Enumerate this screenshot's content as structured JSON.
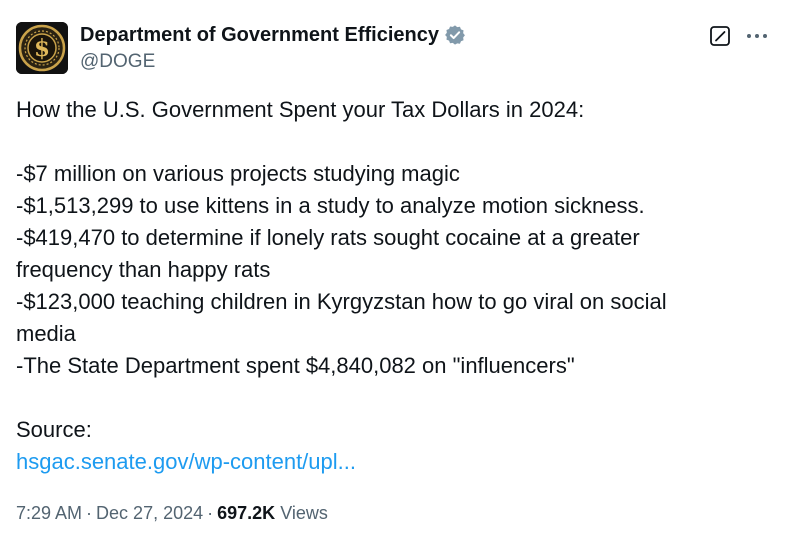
{
  "author": {
    "display_name": "Department of Government Efficiency",
    "handle": "@DOGE",
    "avatar_icon": "dollar-seal-icon",
    "verified_icon": "verified-badge-icon",
    "verified_color": "#829aab"
  },
  "actions": {
    "grok_icon": "grok-icon",
    "more_icon": "more-dots-icon"
  },
  "tweet": {
    "line1": "How the U.S. Government Spent your Tax Dollars in 2024:",
    "items": [
      "-$7 million on various projects studying magic",
      "-$1,513,299 to use kittens in a study to analyze motion sickness.",
      "-$419,470 to determine if lonely rats sought cocaine at a greater",
      "frequency than happy rats",
      "-$123,000 teaching children in Kyrgyzstan how to go viral on social",
      "media",
      "-The State Department spent $4,840,082 on \"influencers\""
    ],
    "source_label": "Source:",
    "source_link": "hsgac.senate.gov/wp-content/upl..."
  },
  "meta": {
    "time": "7:29 AM",
    "separator": "·",
    "date": "Dec 27, 2024",
    "views_count": "697.2K",
    "views_label": "Views"
  },
  "colors": {
    "text": "#0f1419",
    "secondary": "#536471",
    "link": "#1d9bf0",
    "avatar_gold": "#c9a24a"
  }
}
